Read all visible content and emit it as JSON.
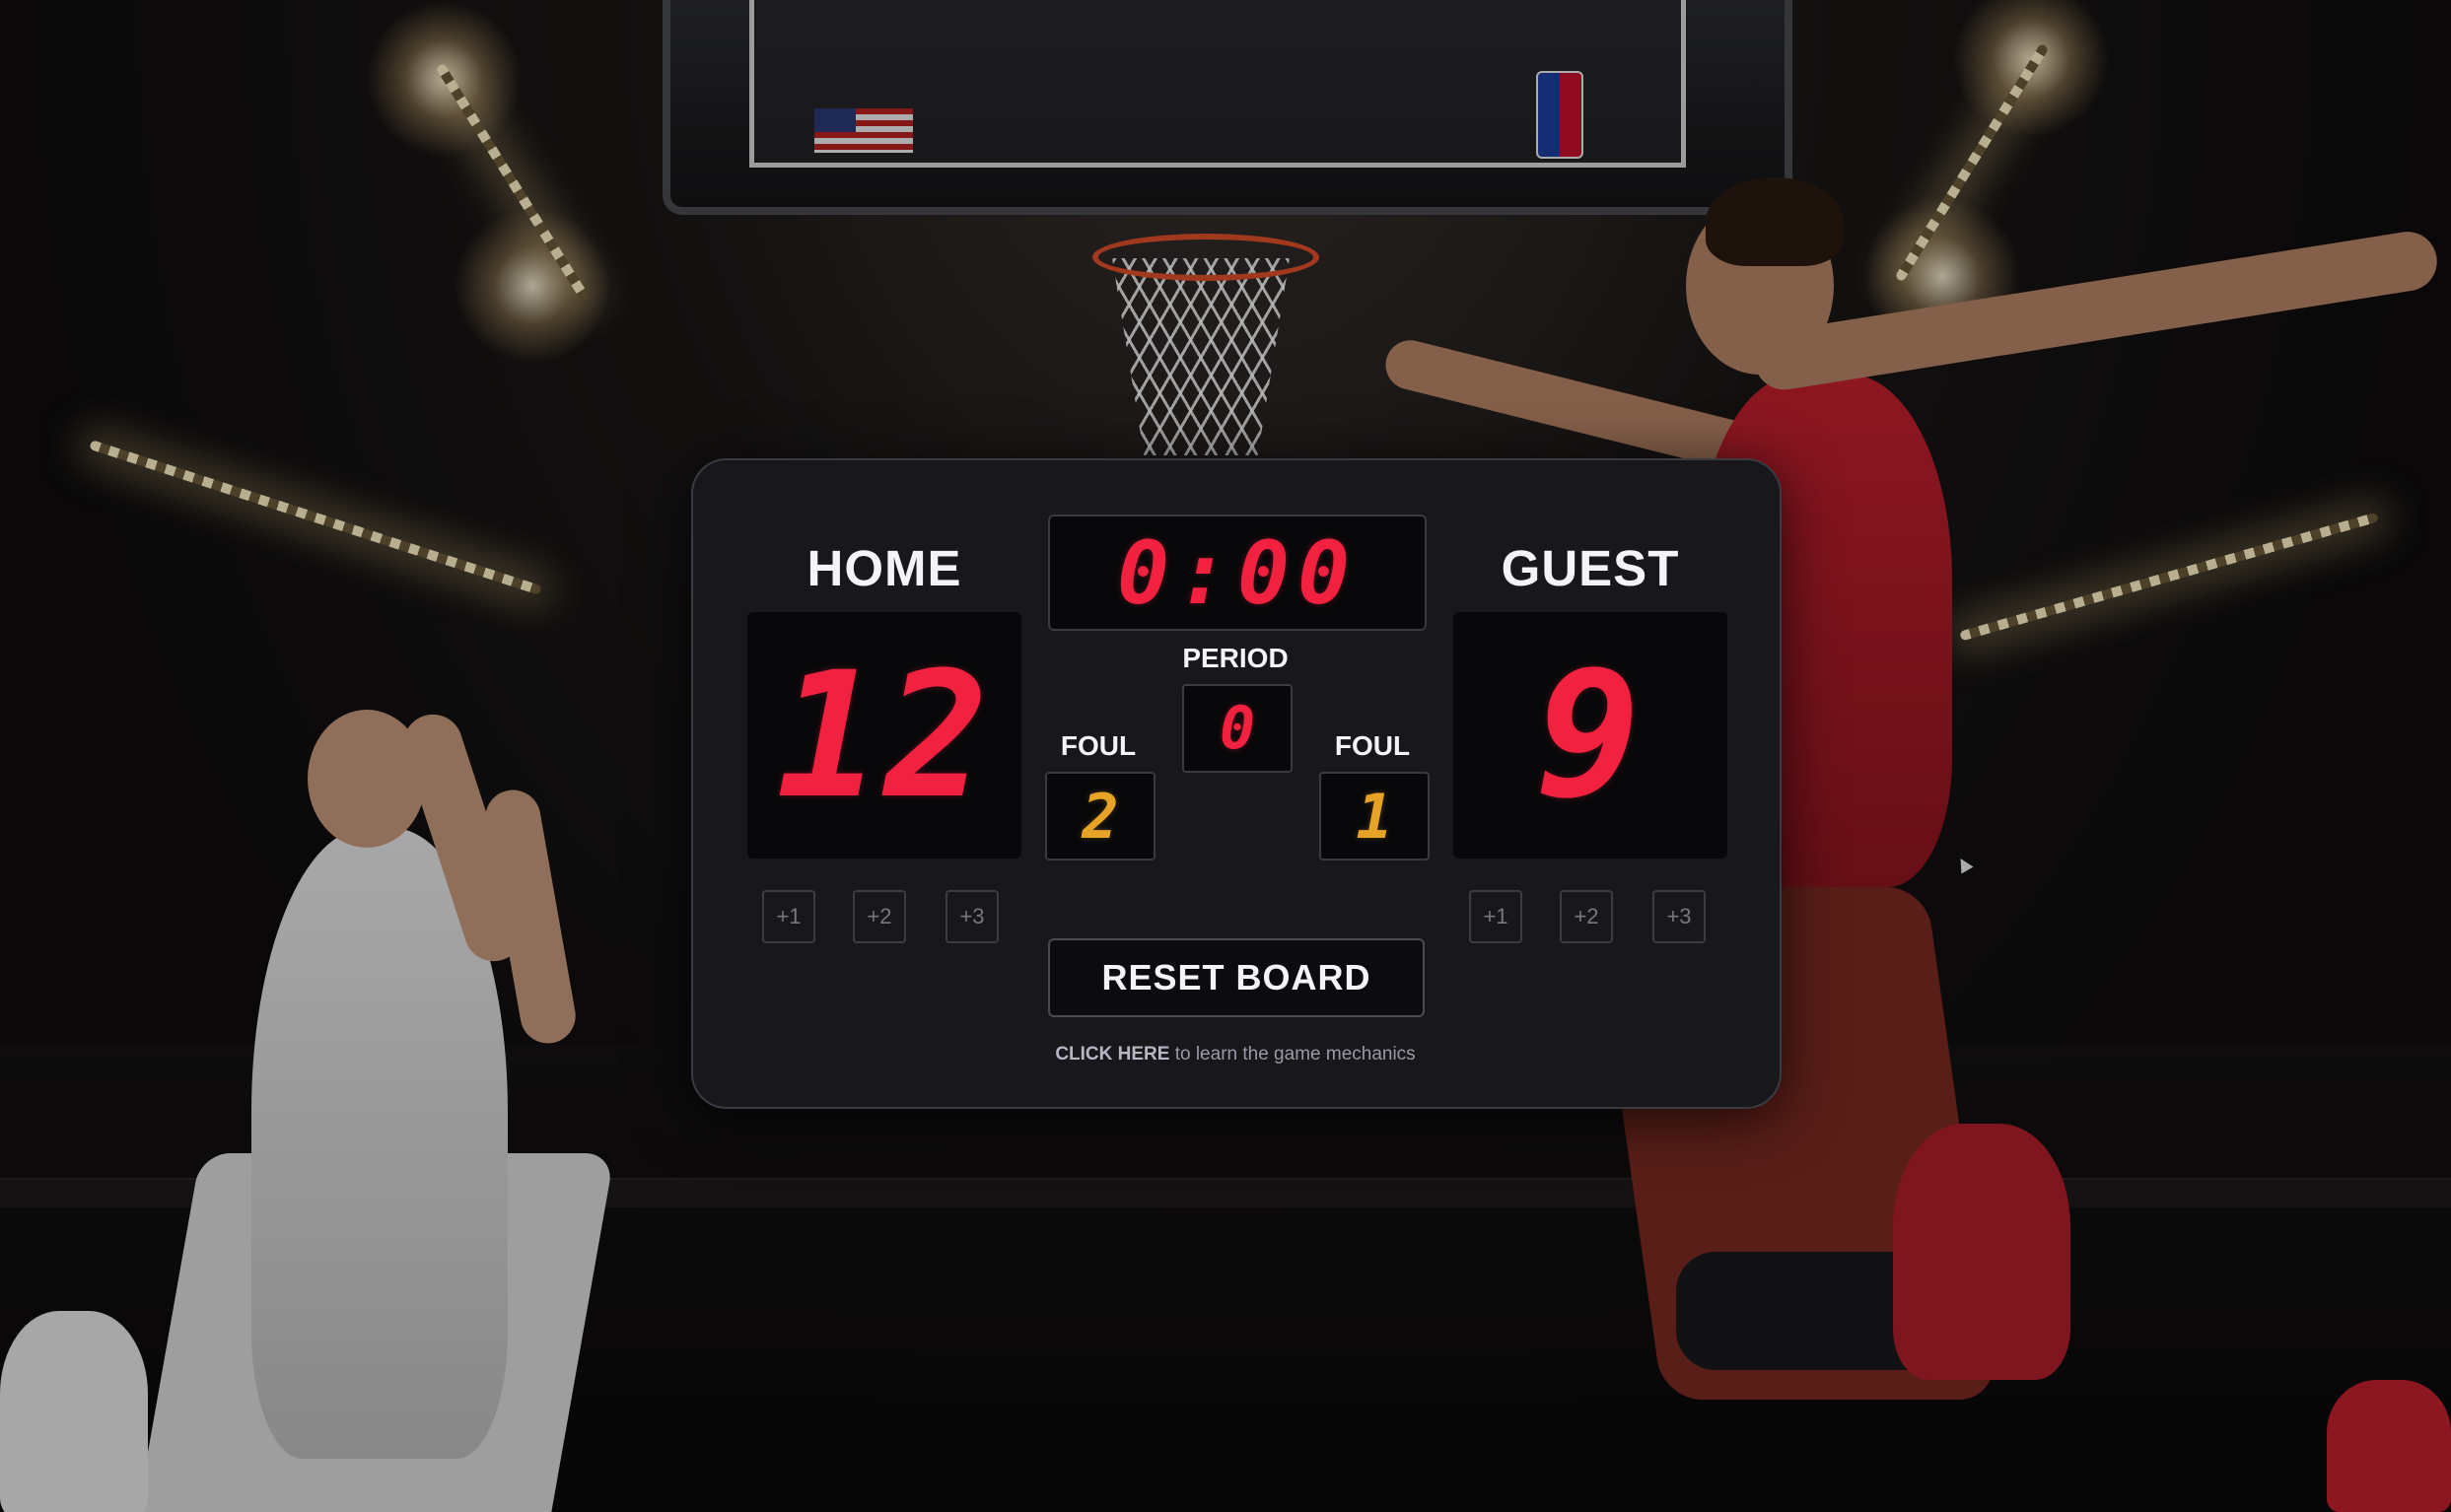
{
  "home": {
    "title": "HOME",
    "score": "12",
    "fouls": "2",
    "buttons": [
      "+1",
      "+2",
      "+3"
    ]
  },
  "guest": {
    "title": "GUEST",
    "score": "9",
    "fouls": "1",
    "buttons": [
      "+1",
      "+2",
      "+3"
    ]
  },
  "timer": "0:00",
  "period": {
    "label": "PERIOD",
    "value": "0"
  },
  "foul_label": "FOUL",
  "reset_label": "RESET BOARD",
  "help": {
    "link": "CLICK HERE",
    "text": " to learn the game mechanics"
  },
  "colors": {
    "score_digits": "#f1213f",
    "foul_digits": "#e7a326",
    "panel_bg": "#17171c"
  }
}
